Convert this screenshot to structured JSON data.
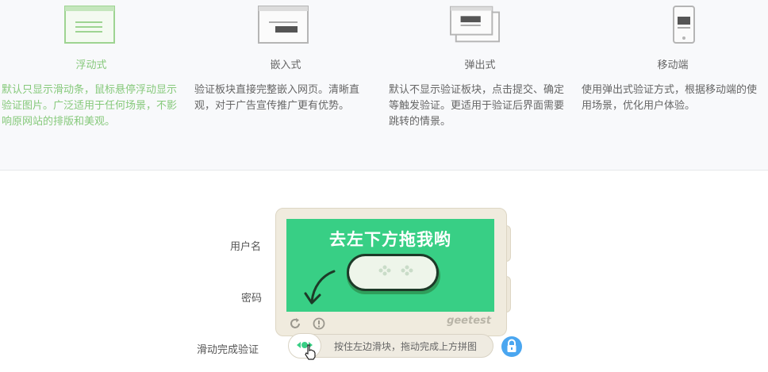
{
  "modes": [
    {
      "title": "浮动式",
      "desc": "默认只显示滑动条，鼠标悬停浮动显示验证图片。广泛适用于任何场景，不影响原网站的排版和美观。",
      "icon": "float-mode-icon",
      "active": true
    },
    {
      "title": "嵌入式",
      "desc": "验证板块直接完整嵌入网页。清晰直观，对于广告宣传推广更有优势。",
      "icon": "embed-mode-icon",
      "active": false
    },
    {
      "title": "弹出式",
      "desc": "默认不显示验证板块，点击提交、确定等触发验证。更适用于验证后界面需要跳转的情景。",
      "icon": "popup-mode-icon",
      "active": false
    },
    {
      "title": "移动端",
      "desc": "使用弹出式验证方式，根据移动端的使用场景，优化用户体验。",
      "icon": "mobile-mode-icon",
      "active": false
    }
  ],
  "form": {
    "username_label": "用户名",
    "password_label": "密码",
    "verify_label": "滑动完成验证"
  },
  "captcha": {
    "instruction": "去左下方拖我哟",
    "brand": "geetest",
    "slider_hint": "按住左边滑块，拖动完成上方拼图"
  },
  "colors": {
    "active_green": "#86c97b",
    "captcha_bg": "#38cf85",
    "lock_blue": "#4aa6f0"
  }
}
